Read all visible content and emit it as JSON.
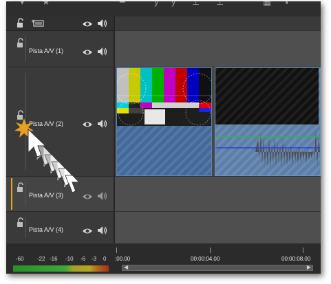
{
  "header": {
    "icons": [
      "lock-icon",
      "add-track-icon",
      "eye-icon",
      "speaker-icon"
    ]
  },
  "tracks": [
    {
      "label": "Pista A/V (1)"
    },
    {
      "label": "Pista A/V (2)"
    },
    {
      "label": "Pista A/V (3)",
      "visible_label": "Pista A/V (3)"
    },
    {
      "label": "Pista A/V (4)"
    }
  ],
  "meter": {
    "ticks": [
      "-60",
      "-22",
      "-16",
      "-10",
      "-6",
      "-3",
      "0"
    ]
  },
  "ruler": {
    "t0": ":00.00",
    "t1": "00:00:04.00",
    "t2": "00:00:08.00"
  },
  "colors": {
    "selected_track_accent": "#f0a020",
    "clip_fill": "#41699a",
    "waveform_green": "#33b24c",
    "waveform_blue": "#2f3ee0"
  }
}
